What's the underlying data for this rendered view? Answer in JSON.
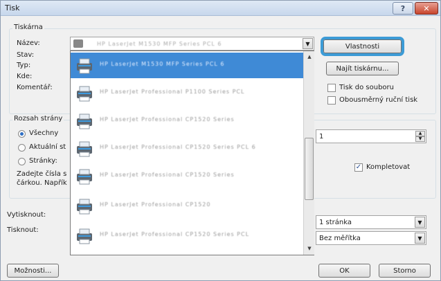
{
  "window": {
    "title": "Tisk",
    "help_btn": "?",
    "close_btn": "✕"
  },
  "printer": {
    "group_label": "Tiskárna",
    "name_label": "Název:",
    "status_label": "Stav:",
    "type_label": "Typ:",
    "where_label": "Kde:",
    "comment_label": "Komentář:",
    "properties_btn": "Vlastnosti",
    "find_btn": "Najít tiskárnu...",
    "print_to_file": "Tisk do souboru",
    "manual_duplex": "Obousměrný ruční tisk",
    "list_items": [
      "HP LaserJet M1530 MFP Series PCL 6",
      "HP LaserJet Professional P1100 Series PCL",
      "HP LaserJet Professional CP1520 Series",
      "HP LaserJet Professional CP1520 Series PCL 6",
      "HP LaserJet Professional CP1520 Series",
      "HP LaserJet Professional CP1520",
      "HP LaserJet Professional CP1520 Series PCL"
    ],
    "combo_value": "HP LaserJet M1530 MFP Series PCL 6"
  },
  "range": {
    "group_label": "Rozsah strány",
    "all": "Všechny",
    "current": "Aktuální st",
    "pages": "Stránky:",
    "hint_line1": "Zadejte čísla s",
    "hint_line2": "čárkou. Napřík"
  },
  "copies": {
    "value": "1",
    "collate": "Kompletovat"
  },
  "print": {
    "what_label": "Vytisknout:",
    "print_label": "Tisknout:",
    "pages_per_sheet": "1 stránka",
    "scaling": "Bez měřítka"
  },
  "footer": {
    "options_btn": "Možnosti...",
    "ok_btn": "OK",
    "cancel_btn": "Storno"
  }
}
